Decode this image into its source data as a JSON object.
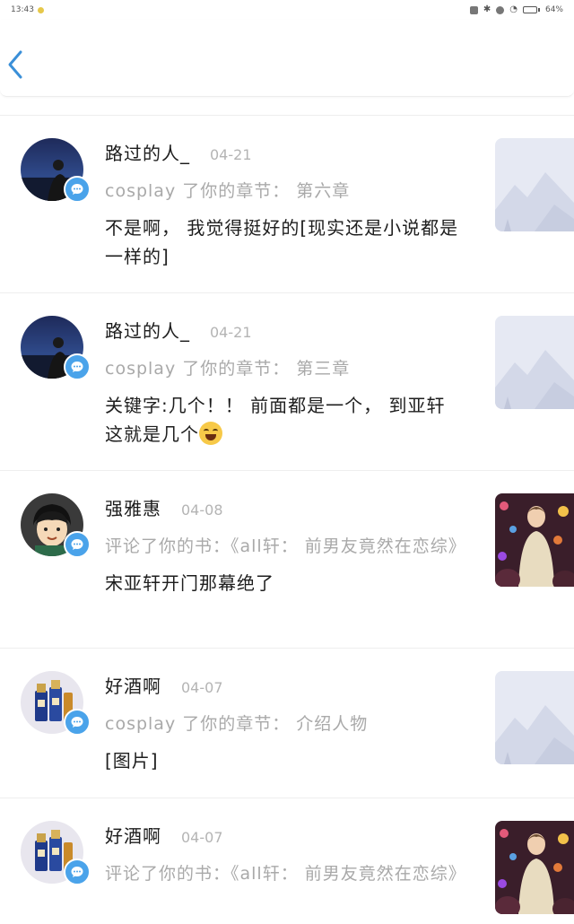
{
  "status_bar": {
    "time": "13:43",
    "battery_text": "64%",
    "battery_level": 0.64
  },
  "header": {
    "back_icon": "chevron-left-icon"
  },
  "items": [
    {
      "user": "路过的人_",
      "date": "04-21",
      "action": "cosplay 了你的章节： 第六章",
      "comment": "不是啊， 我觉得挺好的[现实还是小说都是一样的]",
      "avatar": "night-portrait",
      "thumb": "placeholder-mountains"
    },
    {
      "user": "路过的人_",
      "date": "04-21",
      "action": "cosplay 了你的章节： 第三章",
      "comment": "关键字:几个！！ 前面都是一个， 到亚轩这就是几个",
      "comment_emoji": "laughing-crying-emoji",
      "avatar": "night-portrait",
      "thumb": "placeholder-mountains"
    },
    {
      "user": "强雅惠",
      "date": "04-08",
      "action": "评论了你的书：《all轩： 前男友竟然在恋综》",
      "comment": "宋亚轩开门那幕绝了",
      "avatar": "cartoon-boy",
      "thumb": "concert-photo"
    },
    {
      "user": "好酒啊",
      "date": "04-07",
      "action": "cosplay 了你的章节： 介绍人物",
      "comment": "[图片]",
      "avatar": "liquor-bottles",
      "thumb": "placeholder-mountains"
    },
    {
      "user": "好酒啊",
      "date": "04-07",
      "action": "评论了你的书：《all轩： 前男友竟然在恋综》",
      "comment": "",
      "avatar": "liquor-bottles",
      "thumb": "concert-photo"
    }
  ],
  "colors": {
    "accent": "#4aa3ea",
    "back_arrow": "#3a8fd8",
    "secondary_text": "#a9a9a9",
    "divider": "#eeeeee"
  }
}
